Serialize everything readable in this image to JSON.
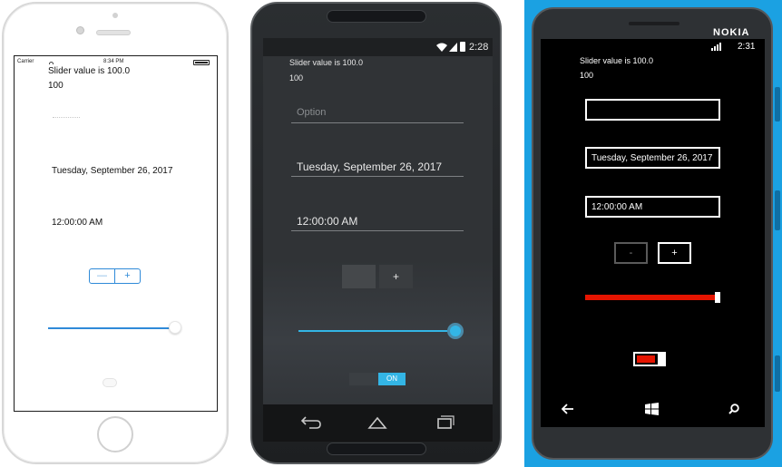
{
  "ios": {
    "status": {
      "carrier": "Carrier",
      "time": "8:34 PM"
    },
    "slider_text": "Slider value is 100.0",
    "value_text": "100",
    "date_text": "Tuesday, September 26, 2017",
    "time_text": "12:00:00 AM",
    "stepper": {
      "minus": "—",
      "plus": "+"
    },
    "slider_fraction": 1.0,
    "colors": {
      "accent": "#2f8ad8"
    }
  },
  "android": {
    "status": {
      "time": "2:28"
    },
    "slider_text": "Slider value is 100.0",
    "value_text": "100",
    "entry_placeholder": "Option",
    "date_text": "Tuesday, September 26, 2017",
    "time_text": "12:00:00 AM",
    "stepper": {
      "plus": "+"
    },
    "switch_label": "ON",
    "slider_fraction": 1.0,
    "colors": {
      "accent": "#33b5e5"
    }
  },
  "windows": {
    "status": {
      "time": "2:31"
    },
    "brand": "NOKIA",
    "slider_text": "Slider value is 100.0",
    "value_text": "100",
    "date_text": "Tuesday, September 26, 2017",
    "time_text": "12:00:00 AM",
    "stepper": {
      "minus": "-",
      "plus": "+"
    },
    "slider_fraction": 1.0,
    "colors": {
      "accent": "#e51400",
      "frame": "#1ba1e2"
    }
  }
}
